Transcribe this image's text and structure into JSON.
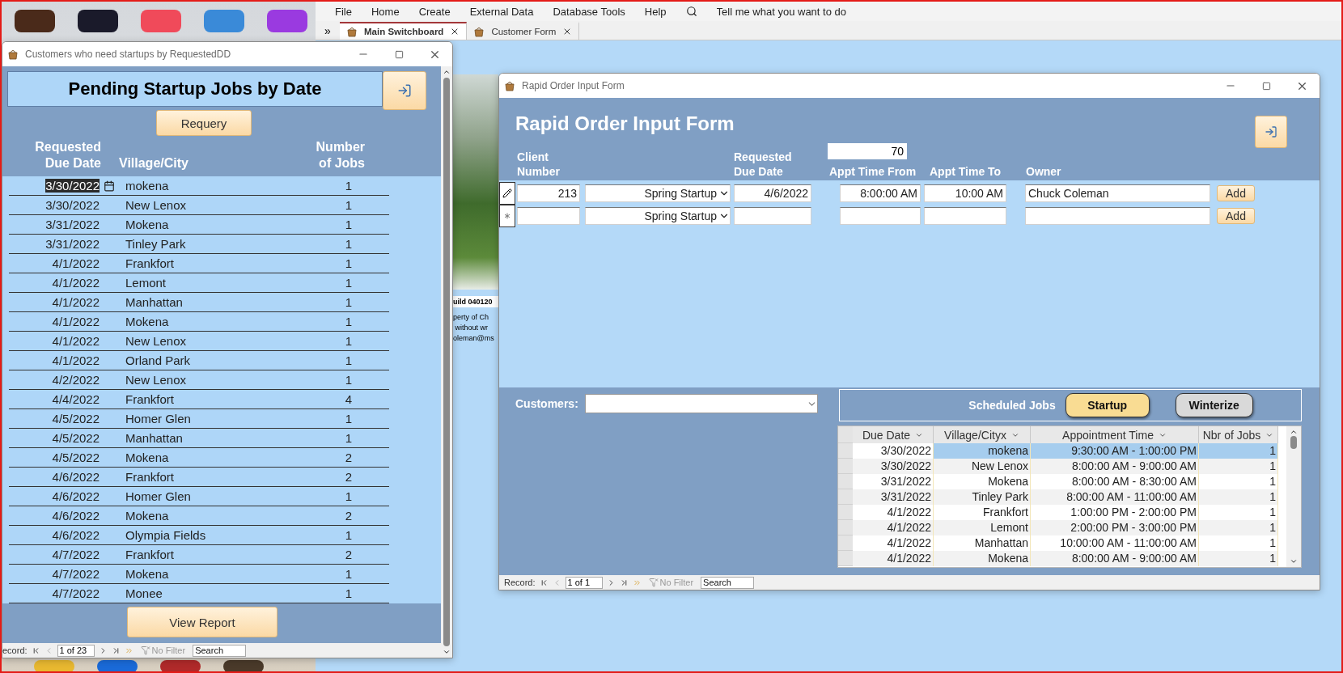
{
  "access": {
    "menu": [
      "File",
      "Home",
      "Create",
      "External Data",
      "Database Tools",
      "Help"
    ],
    "search": {
      "placeholder": "Tell me what you want to do"
    },
    "overflow": "»",
    "tabs": [
      {
        "label": "Main Switchboard",
        "selected": true
      },
      {
        "label": "Customer Form",
        "selected": false
      }
    ]
  },
  "switchboard": {
    "build": "uild 040120",
    "notes": [
      "perty of Ch",
      " without wr",
      "oleman@ms"
    ]
  },
  "pending": {
    "title": "Customers who need startups by RequestedDD",
    "heading": "Pending Startup Jobs by Date",
    "requery": "Requery",
    "columns": [
      "Requested\nDue Date",
      "Village/City",
      "Number\nof Jobs"
    ],
    "rows": [
      {
        "date": "3/30/2022",
        "city": "mokena",
        "jobs": "1",
        "selected": true
      },
      {
        "date": "3/30/2022",
        "city": "New Lenox",
        "jobs": "1",
        "selected": false
      },
      {
        "date": "3/31/2022",
        "city": "Mokena",
        "jobs": "1",
        "selected": false
      },
      {
        "date": "3/31/2022",
        "city": "Tinley Park",
        "jobs": "1",
        "selected": false
      },
      {
        "date": "4/1/2022",
        "city": "Frankfort",
        "jobs": "1",
        "selected": false
      },
      {
        "date": "4/1/2022",
        "city": "Lemont",
        "jobs": "1",
        "selected": false
      },
      {
        "date": "4/1/2022",
        "city": "Manhattan",
        "jobs": "1",
        "selected": false
      },
      {
        "date": "4/1/2022",
        "city": "Mokena",
        "jobs": "1",
        "selected": false
      },
      {
        "date": "4/1/2022",
        "city": "New Lenox",
        "jobs": "1",
        "selected": false
      },
      {
        "date": "4/1/2022",
        "city": "Orland Park",
        "jobs": "1",
        "selected": false
      },
      {
        "date": "4/2/2022",
        "city": "New Lenox",
        "jobs": "1",
        "selected": false
      },
      {
        "date": "4/4/2022",
        "city": "Frankfort",
        "jobs": "4",
        "selected": false
      },
      {
        "date": "4/5/2022",
        "city": "Homer Glen",
        "jobs": "1",
        "selected": false
      },
      {
        "date": "4/5/2022",
        "city": "Manhattan",
        "jobs": "1",
        "selected": false
      },
      {
        "date": "4/5/2022",
        "city": "Mokena",
        "jobs": "2",
        "selected": false
      },
      {
        "date": "4/6/2022",
        "city": "Frankfort",
        "jobs": "2",
        "selected": false
      },
      {
        "date": "4/6/2022",
        "city": "Homer Glen",
        "jobs": "1",
        "selected": false
      },
      {
        "date": "4/6/2022",
        "city": "Mokena",
        "jobs": "2",
        "selected": false
      },
      {
        "date": "4/6/2022",
        "city": "Olympia Fields",
        "jobs": "1",
        "selected": false
      },
      {
        "date": "4/7/2022",
        "city": "Frankfort",
        "jobs": "2",
        "selected": false
      },
      {
        "date": "4/7/2022",
        "city": "Mokena",
        "jobs": "1",
        "selected": false
      },
      {
        "date": "4/7/2022",
        "city": "Monee",
        "jobs": "1",
        "selected": false
      }
    ],
    "view_report": "View Report",
    "nav": {
      "label": "ecord:",
      "position": "1 of 23",
      "filter": "No Filter",
      "placeholder": "Search"
    }
  },
  "rapid": {
    "title": "Rapid Order Input Form",
    "heading": "Rapid Order Input Form",
    "counter": "70",
    "columns": [
      "Client\nNumber",
      "Requested\nDue Date",
      "Appt Time From",
      "Appt Time To",
      "Owner"
    ],
    "orders": [
      {
        "kind": "edit",
        "client": "213",
        "type": "Spring Startup",
        "due": "4/6/2022",
        "from": "8:00:00 AM",
        "to": "10:00 AM",
        "owner": "Chuck Coleman",
        "button": "Add"
      },
      {
        "kind": "new",
        "type": "Spring Startup",
        "button": "Add"
      }
    ],
    "customers": {
      "label": "Customers:"
    },
    "scheduled": {
      "label": "Scheduled Jobs",
      "filters": [
        {
          "label": "Startup",
          "selected": true
        },
        {
          "label": "Winterize",
          "selected": false
        }
      ],
      "columns": [
        "Due Date",
        "Village/Cityx",
        "Appointment Time",
        "Nbr of Jobs"
      ],
      "rows": [
        {
          "date": "3/30/2022",
          "city": "mokena",
          "time": "9:30:00 AM - 1:00:00 PM",
          "jobs": "1",
          "selected": true
        },
        {
          "date": "3/30/2022",
          "city": "New Lenox",
          "time": "8:00:00 AM - 9:00:00 AM",
          "jobs": "1",
          "selected": false
        },
        {
          "date": "3/31/2022",
          "city": "Mokena",
          "time": "8:00:00 AM - 8:30:00 AM",
          "jobs": "1",
          "selected": false
        },
        {
          "date": "3/31/2022",
          "city": "Tinley Park",
          "time": "8:00:00 AM - 11:00:00 AM",
          "jobs": "1",
          "selected": false
        },
        {
          "date": "4/1/2022",
          "city": "Frankfort",
          "time": "1:00:00 PM - 2:00:00 PM",
          "jobs": "1",
          "selected": false
        },
        {
          "date": "4/1/2022",
          "city": "Lemont",
          "time": "2:00:00 PM - 3:00:00 PM",
          "jobs": "1",
          "selected": false
        },
        {
          "date": "4/1/2022",
          "city": "Manhattan",
          "time": "10:00:00 AM - 11:00:00 AM",
          "jobs": "1",
          "selected": false
        },
        {
          "date": "4/1/2022",
          "city": "Mokena",
          "time": "8:00:00 AM - 9:00:00 AM",
          "jobs": "1",
          "selected": false
        }
      ]
    },
    "nav": {
      "label": "Record:",
      "position": "1 of 1",
      "filter": "No Filter",
      "placeholder": "Search"
    }
  }
}
